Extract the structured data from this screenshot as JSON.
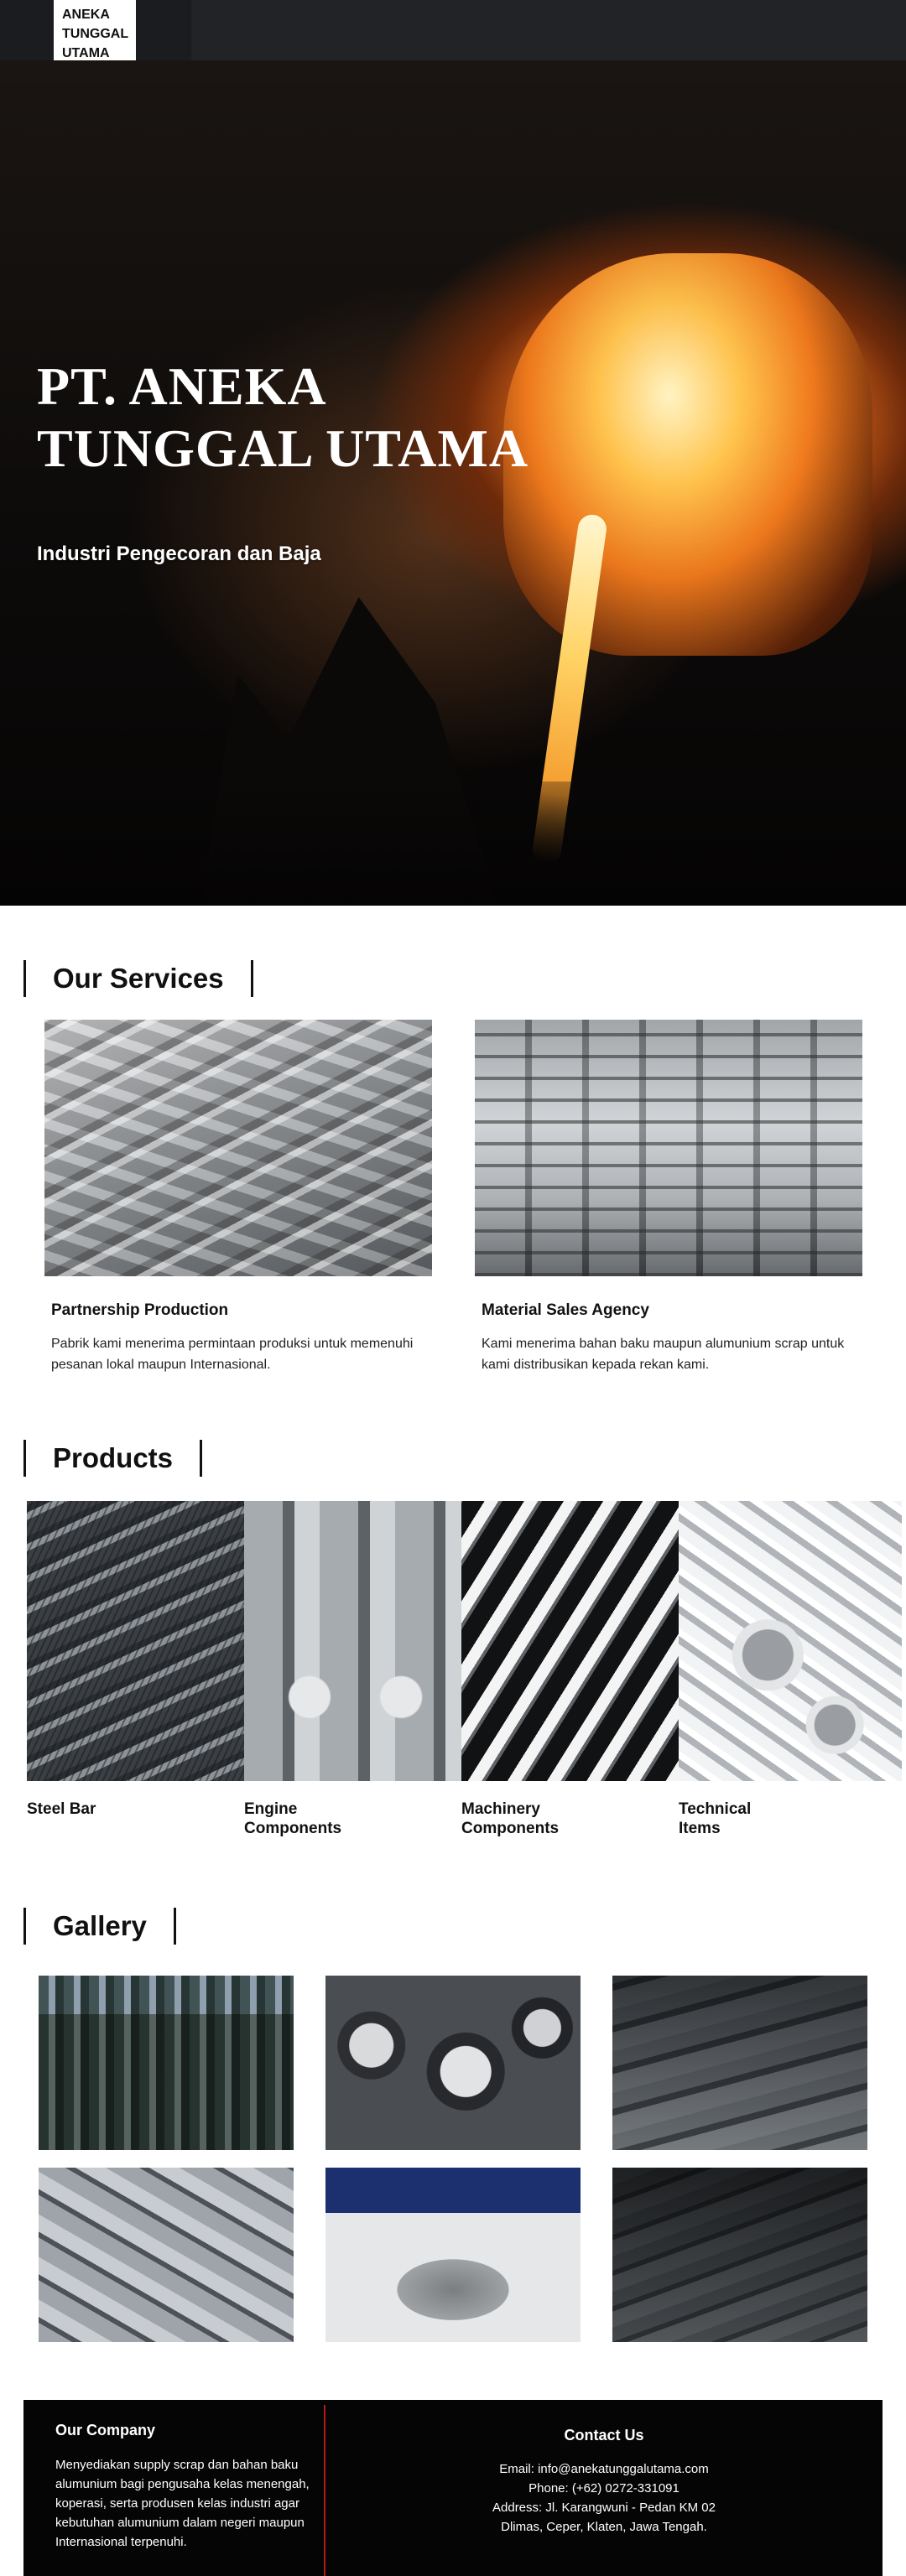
{
  "header": {
    "logo_lines": [
      "ANEKA",
      "TUNGGAL",
      "UTAMA"
    ]
  },
  "hero": {
    "title_line1": "PT. ANEKA",
    "title_line2": "TUNGGAL UTAMA",
    "subtitle": "Industri Pengecoran dan Baja"
  },
  "services": {
    "heading": "Our Services",
    "items": [
      {
        "title": "Partnership Production",
        "description": "Pabrik kami menerima permintaan produksi untuk memenuhi pesanan lokal maupun Internasional."
      },
      {
        "title": "Material Sales Agency",
        "description": "Kami menerima bahan baku maupun alumunium scrap untuk kami distribusikan kepada rekan kami."
      }
    ]
  },
  "products": {
    "heading": "Products",
    "items": [
      {
        "label": "Steel Bar"
      },
      {
        "label": "Engine Components"
      },
      {
        "label": "Machinery Components"
      },
      {
        "label": "Technical Items"
      }
    ]
  },
  "gallery": {
    "heading": "Gallery"
  },
  "footer": {
    "company_title": "Our Company",
    "company_description": "Menyediakan supply scrap dan bahan baku alumunium bagi pengusaha kelas menengah, koperasi, serta produsen kelas industri agar kebutuhan alumunium dalam negeri maupun Internasional terpenuhi.",
    "contact_title": "Contact Us",
    "email": "Email: info@anekatunggalutama.com",
    "phone": "Phone: (+62) 0272-331091",
    "address_line1": "Address: Jl. Karangwuni - Pedan KM 02",
    "address_line2": "Dlimas, Ceper, Klaten, Jawa Tengah."
  },
  "colors": {
    "topbar": "#222327",
    "footer_bg": "#050505",
    "footer_divider": "#b11c14"
  }
}
